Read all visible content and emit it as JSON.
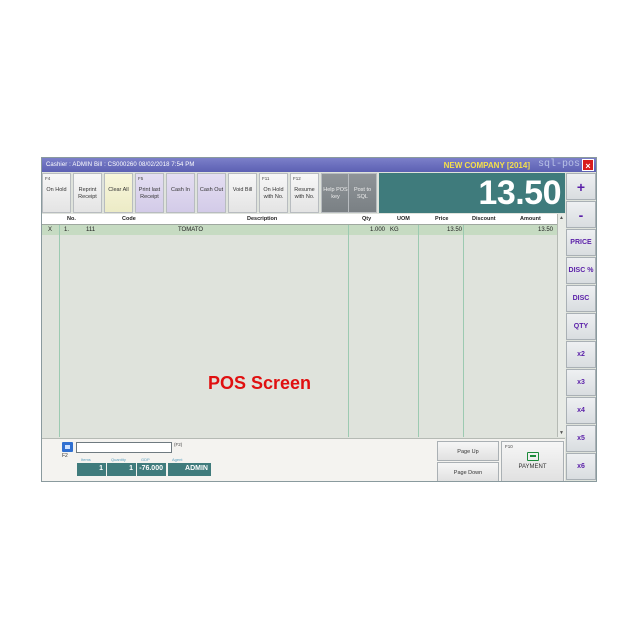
{
  "titlebar": {
    "info": "Cashier : ADMIN      Bill : CS000260    08/02/2018    7:54 PM",
    "company": "NEW COMPANY [2014]",
    "logo": "sql-pos",
    "close_label": "×"
  },
  "toolbar": [
    {
      "fkey": "F4",
      "label": "On Hold"
    },
    {
      "fkey": "",
      "label": "Reprint Receipt"
    },
    {
      "fkey": "",
      "label": "Clear All"
    },
    {
      "fkey": "F5",
      "label": "Print last Receipt"
    },
    {
      "fkey": "",
      "label": "Cash In"
    },
    {
      "fkey": "",
      "label": "Cash Out"
    },
    {
      "fkey": "",
      "label": "Void Bill"
    },
    {
      "fkey": "F11",
      "label": "On Hold with No."
    },
    {
      "fkey": "F12",
      "label": "Resume with No."
    },
    {
      "fkey": "",
      "label": "Help POS key"
    },
    {
      "fkey": "",
      "label": "Post to SQL"
    }
  ],
  "total": "13.50",
  "side_buttons": [
    "+",
    "-",
    "PRICE",
    "DISC %",
    "DISC",
    "QTY",
    "x2",
    "x3",
    "x4",
    "x5",
    "x6"
  ],
  "grid": {
    "columns": [
      "No.",
      "Code",
      "Description",
      "Qty",
      "UOM",
      "Price",
      "Discount",
      "Amount"
    ],
    "rows": [
      {
        "x": "X",
        "no": "1.",
        "code": "111",
        "description": "TOMATO",
        "qty": "1.000",
        "uom": "KG",
        "price": "13.50",
        "discount": "",
        "amount": "13.50"
      }
    ]
  },
  "overlay_text": "POS Screen",
  "bottom": {
    "f2_label": "F2",
    "f2_tag": "(F2)",
    "input_value": "",
    "items_caption": "Items",
    "items": "1",
    "quantity_caption": "Quantity",
    "quantity": "1",
    "gdp_caption": "GDP",
    "gdp": "-76.000",
    "agent_caption": "Agent",
    "agent": "ADMIN",
    "page_up": "Page Up",
    "page_down": "Page Down",
    "pay_fkey": "F10",
    "payment": "PAYMENT"
  },
  "colors": {
    "titlebar": "#5c60b3",
    "total_bg": "#3f7b7c",
    "row_highlight": "#c6dbc2",
    "side_text": "#5a1fa8",
    "overlay": "#e01010"
  }
}
